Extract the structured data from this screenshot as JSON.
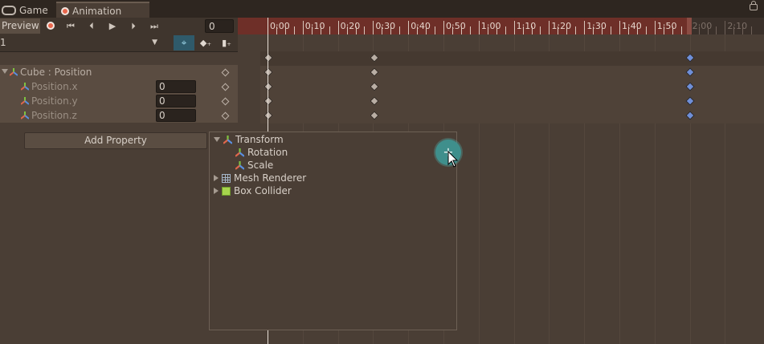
{
  "tabs": [
    {
      "label": "Game",
      "icon": "game-controller-icon"
    },
    {
      "label": "Animation",
      "icon": "animation-record-icon"
    }
  ],
  "toolbar": {
    "preview_label": "Preview",
    "frame_value": "0"
  },
  "clip": {
    "selected": "1"
  },
  "ruler": {
    "labels": [
      "0:00",
      "0:10",
      "0:20",
      "0:30",
      "0:40",
      "0:50",
      "1:00",
      "1:10",
      "1:20",
      "1:30",
      "1:40",
      "1:50",
      "2:00",
      "2:10"
    ]
  },
  "properties": {
    "group_label": "Cube : Position",
    "items": [
      {
        "label": "Position.x",
        "value": "0"
      },
      {
        "label": "Position.y",
        "value": "0"
      },
      {
        "label": "Position.z",
        "value": "0"
      }
    ]
  },
  "add_property_label": "Add Property",
  "popup": {
    "items": [
      {
        "label": "Transform",
        "icon": "transform-icon",
        "expanded": true
      },
      {
        "label": "Rotation",
        "icon": "transform-icon",
        "child": true
      },
      {
        "label": "Scale",
        "icon": "transform-icon",
        "child": true
      },
      {
        "label": "Mesh Renderer",
        "icon": "mesh-renderer-icon",
        "expanded": false
      },
      {
        "label": "Box Collider",
        "icon": "box-collider-icon",
        "expanded": false
      }
    ],
    "add_glyph": "+"
  },
  "colors": {
    "background": "#4a3e35",
    "ruler_active": "#6e2f28",
    "key_default": "#b9aea4",
    "key_selected": "#6f8fd8",
    "accent_teal": "#3f8f8c"
  }
}
